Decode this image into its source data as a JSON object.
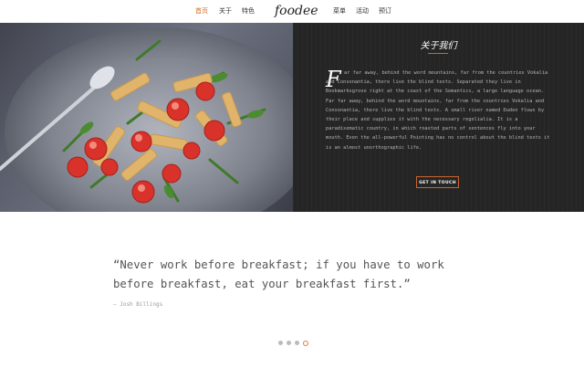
{
  "nav": {
    "items_left": [
      "首页",
      "关于",
      "特色"
    ],
    "brand": "foodee",
    "items_right": [
      "菜单",
      "活动",
      "预订"
    ],
    "active_index": 0
  },
  "hero": {
    "image_alt_icon": "pasta-dish-image"
  },
  "about": {
    "title": "关于我们",
    "dropcap": "F",
    "body": "ar far away, behind the word mountains, far from the countries Vokalia and Consonantia, there live the blind texts. Separated they live in Bookmarksgrove right at the coast of the Semantics, a large language ocean. Far far away, behind the word mountains, far from the countries Vokalia and Consonantia, there live the blind texts. A small river named Duden flows by their place and supplies it with the necessary regelialia. It is a paradisematic country, in which roasted parts of sentences fly into your mouth. Even the all-powerful Pointing has no control about the blind texts it is an almost unorthographic life.",
    "button": "GET IN TOUCH"
  },
  "testimonial": {
    "quote": "“Never work before breakfast; if you have to work before breakfast, eat your breakfast first.”",
    "author": "— Josh Billings"
  },
  "carousel": {
    "count": 4,
    "active": 3,
    "accent": "#e07a3c"
  },
  "colors": {
    "accent": "#c9662e",
    "about_bg": "#252525"
  }
}
